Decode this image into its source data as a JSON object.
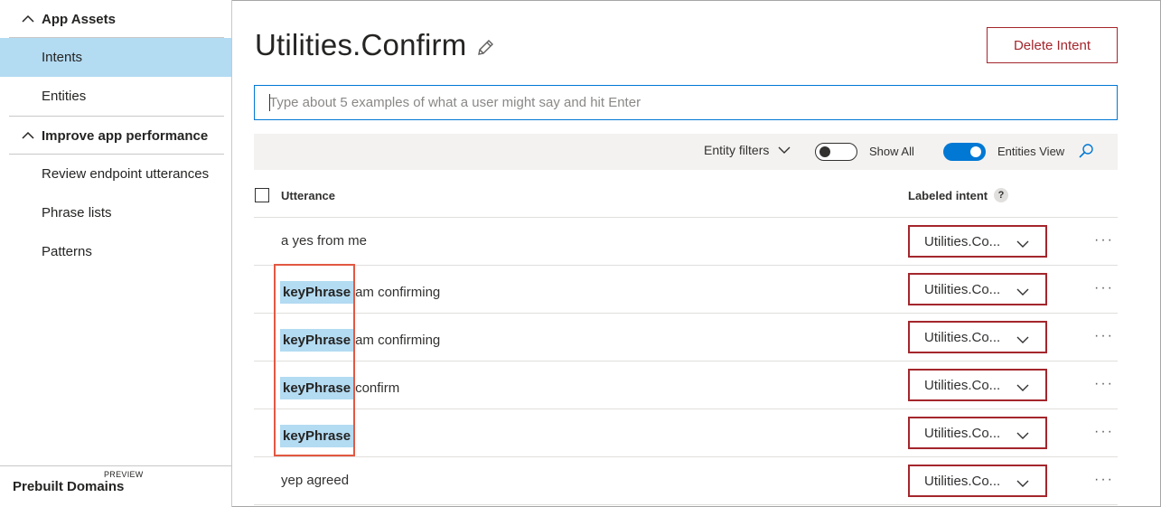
{
  "sidebar": {
    "groups": [
      {
        "label": "App Assets"
      },
      {
        "label": "Improve app performance"
      }
    ],
    "items": [
      {
        "label": "Intents"
      },
      {
        "label": "Entities"
      },
      {
        "label": "Review endpoint utterances"
      },
      {
        "label": "Phrase lists"
      },
      {
        "label": "Patterns"
      }
    ],
    "prebuilt": {
      "label": "Prebuilt Domains",
      "badge": "PREVIEW"
    }
  },
  "page": {
    "title": "Utilities.Confirm",
    "delete_label": "Delete Intent",
    "utterance_placeholder": "Type about 5 examples of what a user might say and hit Enter"
  },
  "toolbar": {
    "entity_filters": "Entity filters",
    "show_all": "Show All",
    "entities_view": "Entities View"
  },
  "table": {
    "col_utterance": "Utterance",
    "col_intent": "Labeled intent",
    "help": "?",
    "more": "···",
    "rows": [
      {
        "token": "",
        "text": "a yes from me",
        "intent": "Utilities.Co..."
      },
      {
        "token": "keyPhrase",
        "text": "am confirming",
        "intent": "Utilities.Co..."
      },
      {
        "token": "keyPhrase",
        "text": "am confirming",
        "intent": "Utilities.Co..."
      },
      {
        "token": "keyPhrase",
        "text": "confirm",
        "intent": "Utilities.Co..."
      },
      {
        "token": "keyPhrase",
        "text": "",
        "intent": "Utilities.Co..."
      },
      {
        "token": "",
        "text": "yep agreed",
        "intent": "Utilities.Co..."
      }
    ]
  },
  "colors": {
    "accent": "#0078d4",
    "selected_nav": "#b3dbf2",
    "danger": "#a4262c",
    "annotation": "#e25842"
  }
}
